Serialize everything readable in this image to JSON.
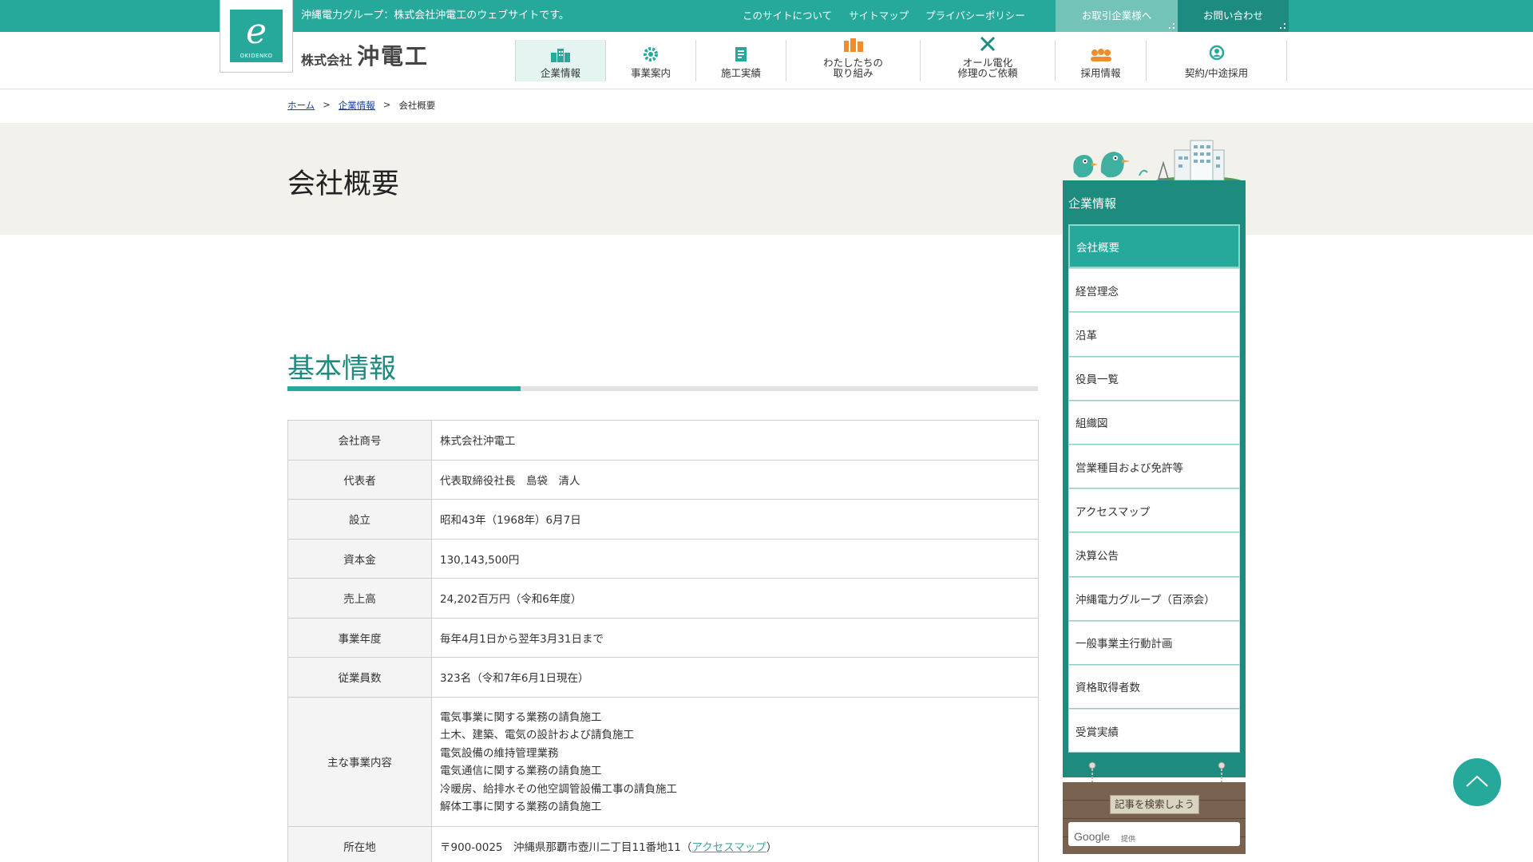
{
  "topbar": {
    "tagline": "沖縄電力グループ：株式会社沖電工のウェブサイトです。",
    "links": [
      "このサイトについて",
      "サイトマップ",
      "プライバシーポリシー"
    ],
    "partner_button": "お取引企業様へ",
    "contact_button": "お問い合わせ"
  },
  "logo": {
    "sub": "OKIDENKO",
    "small": "株式会社",
    "big": "沖電工"
  },
  "nav": [
    {
      "label": "企業情報",
      "icon": "building-icon"
    },
    {
      "label": "事業案内",
      "icon": "gear-icon"
    },
    {
      "label": "施工実績",
      "icon": "document-icon"
    },
    {
      "label": "わたしたちの\n取り組み",
      "icon": "people-icon"
    },
    {
      "label": "オール電化\n修理のご依頼",
      "icon": "tools-icon"
    },
    {
      "label": "採用情報",
      "icon": "group-icon"
    },
    {
      "label": "契約/中途採用",
      "icon": "person-search-icon"
    }
  ],
  "breadcrumb": {
    "home": "ホーム",
    "parent": "企業情報",
    "current": "会社概要",
    "sep": ">"
  },
  "page_title": "会社概要",
  "section_title": "基本情報",
  "info": [
    {
      "label": "会社商号",
      "value": "株式会社沖電工"
    },
    {
      "label": "代表者",
      "value": "代表取締役社長　島袋　清人"
    },
    {
      "label": "設立",
      "value": "昭和43年（1968年）6月7日"
    },
    {
      "label": "資本金",
      "value": "130,143,500円"
    },
    {
      "label": "売上高",
      "value": "24,202百万円（令和6年度）"
    },
    {
      "label": "事業年度",
      "value": "毎年4月1日から翌年3月31日まで"
    },
    {
      "label": "従業員数",
      "value": "323名（令和7年6月1日現在）"
    }
  ],
  "business": {
    "label": "主な事業内容",
    "lines": [
      "電気事業に関する業務の請負施工",
      "土木、建築、電気の設計および請負施工",
      "電気設備の維持管理業務",
      "電気通信に関する業務の請負施工",
      "冷暖房、給排水その他空調管設備工事の請負施工",
      "解体工事に関する業務の請負施工"
    ]
  },
  "address": {
    "label": "所在地",
    "value": "〒900-0025　沖縄県那覇市壺川二丁目11番地11（",
    "link": "アクセスマップ",
    "close": "）"
  },
  "sidebar": {
    "title": "企業情報",
    "items": [
      "会社概要",
      "経営理念",
      "沿革",
      "役員一覧",
      "組織図",
      "営業種目および免許等",
      "アクセスマップ",
      "決算公告",
      "沖縄電力グループ（百添会）",
      "一般事業主行動計画",
      "資格取得者数",
      "受賞実績"
    ],
    "search_sign": "記事を検索しよう",
    "search_brand": "Google",
    "search_provider": "提供"
  },
  "colors": {
    "accent": "#26a99b",
    "accent_dark": "#1d8c7f",
    "link": "#1a3e9a"
  }
}
